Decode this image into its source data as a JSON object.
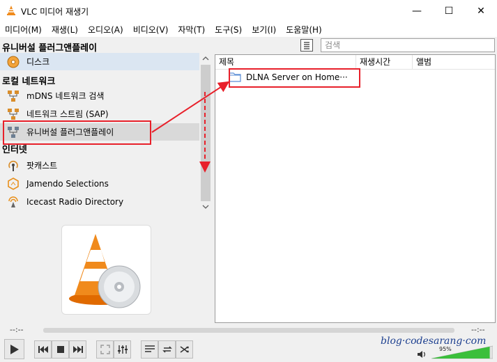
{
  "window": {
    "title": "VLC 미디어 재생기",
    "controls": {
      "minimize": "—",
      "maximize": "☐",
      "close": "✕"
    }
  },
  "menubar": [
    "미디어(M)",
    "재생(L)",
    "오디오(A)",
    "비디오(V)",
    "자막(T)",
    "도구(S)",
    "보기(I)",
    "도움말(H)"
  ],
  "sidebar": {
    "sections": {
      "universal": "유니버설 플러그앤플레이",
      "local": "로컬 네트워크",
      "internet": "인터넷"
    },
    "items": {
      "disc": "디스크",
      "mdns": "mDNS 네트워크 검색",
      "sap": "네트워크 스트림 (SAP)",
      "upnp": "유니버설 플러그앤플레이",
      "podcast": "팟캐스트",
      "jamendo": "Jamendo Selections",
      "icecast": "Icecast Radio Directory"
    }
  },
  "search": {
    "placeholder": "검색"
  },
  "list": {
    "columns": [
      "제목",
      "재생시간",
      "앨범"
    ],
    "rows": [
      {
        "title": "DLNA Server on Home···"
      }
    ]
  },
  "player": {
    "elapsed": "--:--",
    "remaining": "--:--",
    "volume_label": "95%",
    "volume": 0.95
  },
  "watermark": "blog·codesarang·com",
  "colors": {
    "annotation_red": "#e8202a",
    "selected_blue": "#dbe6f2",
    "vlc_orange": "#f08a1c",
    "volume_green": "#3bbf3b"
  }
}
